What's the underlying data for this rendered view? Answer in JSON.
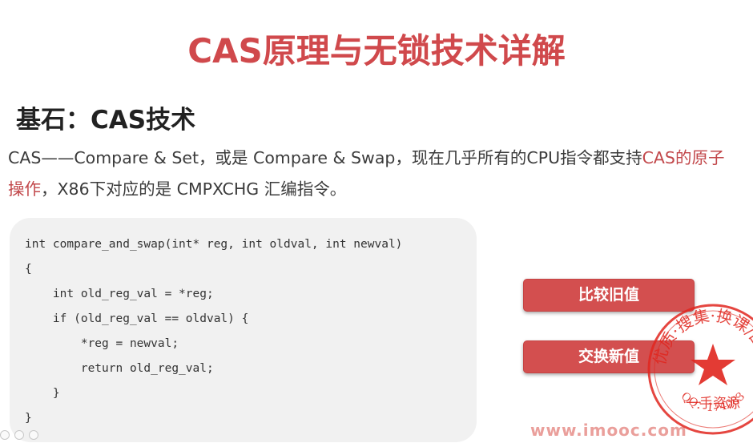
{
  "slide": {
    "title": "CAS原理与无锁技术详解",
    "section_heading": "基石：CAS技术",
    "description": {
      "line1_normal": "CAS——Compare & Set，或是 Compare & Swap，现在几乎所有的CPU指令都支持",
      "line1_accent": "CAS的原子",
      "line2_accent": "操作",
      "line2_normal": "，X86下对应的是 CMPXCHG 汇编指令。"
    }
  },
  "code": {
    "lines": [
      "int compare_and_swap(int* reg, int oldval, int newval)",
      "{",
      "    int old_reg_val = *reg;",
      "    if (old_reg_val == oldval) {",
      "        *reg = newval;",
      "        return old_reg_val;",
      "    }",
      "}"
    ]
  },
  "buttons": {
    "compare_old_label": "比较旧值",
    "swap_new_label": "交换新值"
  },
  "stamp": {
    "arc_text": "优质·搜集·换课/回收",
    "center_text": "一手资源",
    "bottom_text": "QQ：174083"
  },
  "watermark": {
    "text": "www.imooc.com"
  },
  "colors": {
    "title": "#d0494c",
    "accent": "#c2484b",
    "button": "#d34f4f",
    "code_bg": "#f1f1f1",
    "stamp": "#e0261e"
  }
}
